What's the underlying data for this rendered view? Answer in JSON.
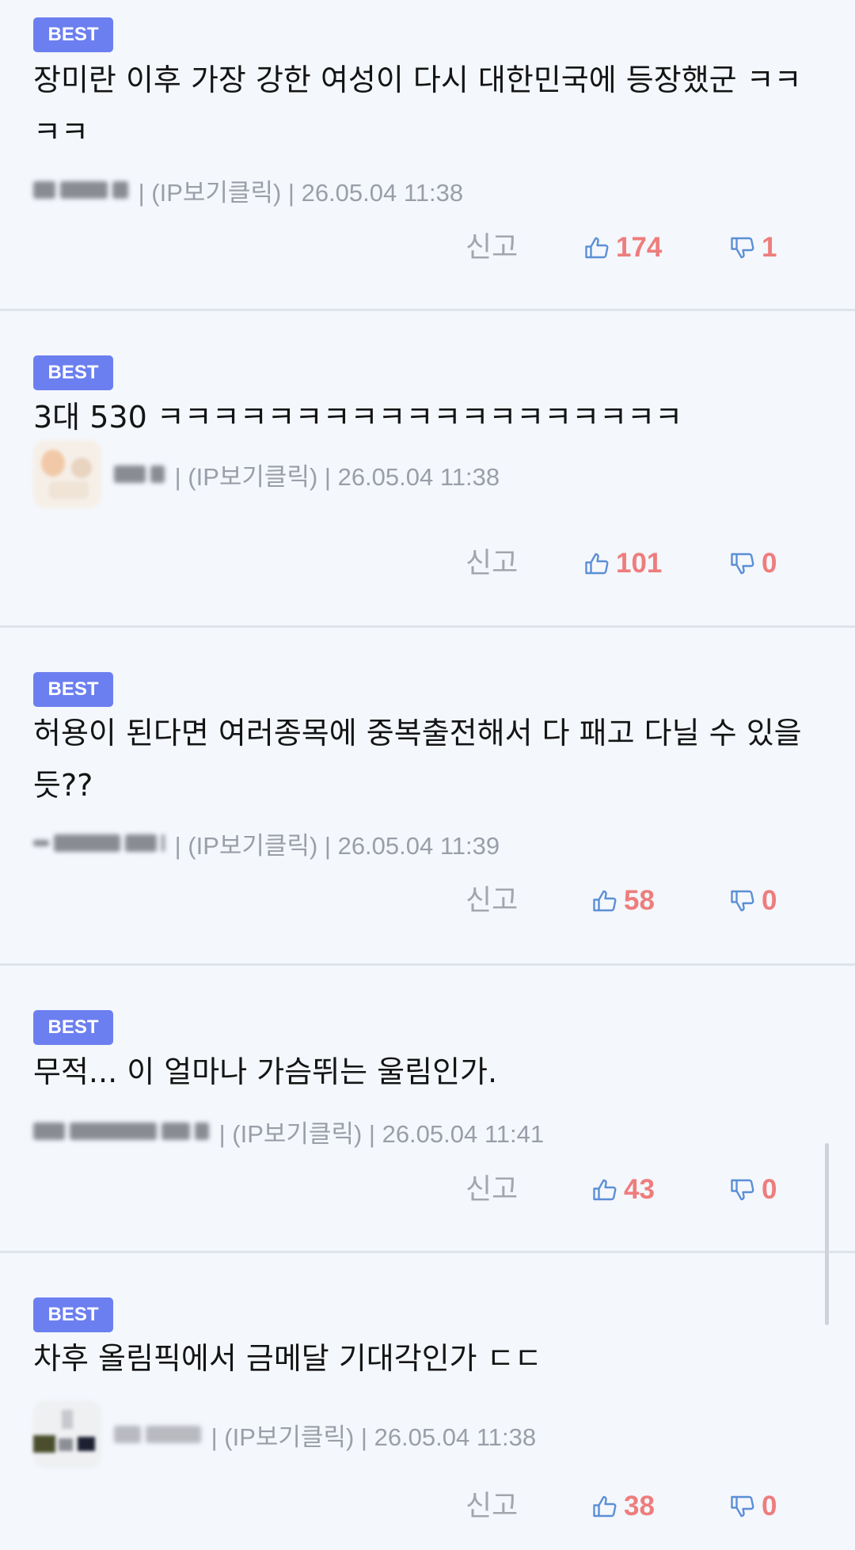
{
  "colors": {
    "background": "#f4f7fc",
    "badge": "#6c7ff0",
    "count": "#ee7d7d",
    "icon": "#5b8fd6",
    "meta": "#9a9ea8",
    "divider": "#dfe3ea"
  },
  "comments": [
    {
      "badge": "BEST",
      "text": "장미란 이후 가장 강한 여성이 다시 대한민국에 등장했군 ㅋㅋㅋㅋ",
      "meta": " | (IP보기클릭) | 26.05.04 11:38",
      "report": "신고",
      "likes": "174",
      "dislikes": "1",
      "like_icon": "thumbs-up-icon",
      "dislike_icon": "thumbs-down-icon"
    },
    {
      "badge": "BEST",
      "text": "3대 530 ㅋㅋㅋㅋㅋㅋㅋㅋㅋㅋㅋㅋㅋㅋㅋㅋㅋㅋㅋ",
      "meta": " | (IP보기클릭) | 26.05.04 11:38",
      "report": "신고",
      "likes": "101",
      "dislikes": "0",
      "like_icon": "thumbs-up-icon",
      "dislike_icon": "thumbs-down-icon"
    },
    {
      "badge": "BEST",
      "text": "허용이 된다면 여러종목에 중복출전해서 다 패고 다닐 수 있을듯??",
      "meta": " | (IP보기클릭) | 26.05.04 11:39",
      "report": "신고",
      "likes": "58",
      "dislikes": "0",
      "like_icon": "thumbs-up-icon",
      "dislike_icon": "thumbs-down-icon"
    },
    {
      "badge": "BEST",
      "text": "무적... 이 얼마나 가슴뛰는 울림인가.",
      "meta": " | (IP보기클릭) | 26.05.04 11:41",
      "report": "신고",
      "likes": "43",
      "dislikes": "0",
      "like_icon": "thumbs-up-icon",
      "dislike_icon": "thumbs-down-icon"
    },
    {
      "badge": "BEST",
      "text": "차후 올림픽에서 금메달 기대각인가 ㄷㄷ",
      "meta": " | (IP보기클릭) | 26.05.04 11:38",
      "report": "신고",
      "likes": "38",
      "dislikes": "0",
      "like_icon": "thumbs-up-icon",
      "dislike_icon": "thumbs-down-icon"
    }
  ]
}
